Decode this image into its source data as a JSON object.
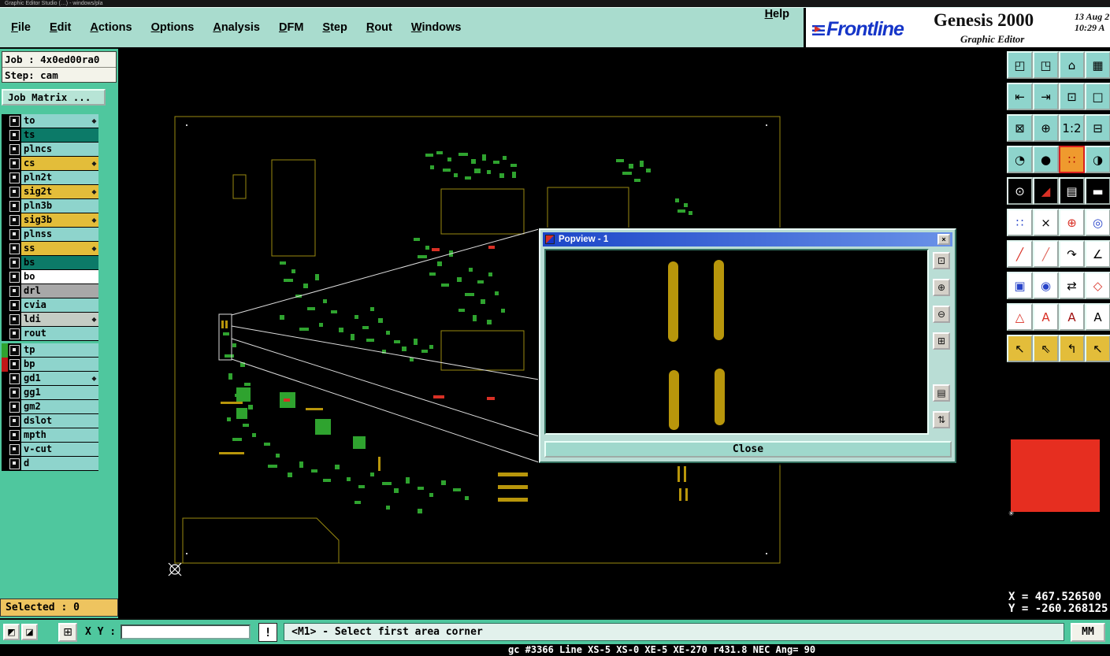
{
  "window_title": "Graphic Editor Studio (…) - windows/pla",
  "menubar": {
    "items": [
      {
        "label": "File",
        "name": "menu-file"
      },
      {
        "label": "Edit",
        "name": "menu-edit"
      },
      {
        "label": "Actions",
        "name": "menu-actions"
      },
      {
        "label": "Options",
        "name": "menu-options"
      },
      {
        "label": "Analysis",
        "name": "menu-analysis"
      },
      {
        "label": "DFM",
        "name": "menu-dfm"
      },
      {
        "label": "Step",
        "name": "menu-step"
      },
      {
        "label": "Rout",
        "name": "menu-rout"
      },
      {
        "label": "Windows",
        "name": "menu-windows"
      }
    ],
    "help_label": "Help"
  },
  "brand": {
    "logo_text": "Frontline",
    "product": "Genesis 2000",
    "subtitle": "Graphic Editor",
    "date": "13 Aug 2",
    "time": "10:29 A"
  },
  "job_panel": {
    "job_line": "Job : 4x0ed00ra0",
    "step_line": "Step: cam",
    "matrix_button": "Job Matrix ..."
  },
  "layers": [
    {
      "name": "to",
      "color": "#8ed4cc",
      "arrow_glyph": "◆",
      "swatch": ""
    },
    {
      "name": "ts",
      "color": "#0c7a68",
      "arrow_glyph": "",
      "swatch": ""
    },
    {
      "name": "plncs",
      "color": "#8ed4cc",
      "arrow_glyph": "",
      "swatch": ""
    },
    {
      "name": "cs",
      "color": "#e3bd3a",
      "arrow_glyph": "◆",
      "swatch": ""
    },
    {
      "name": "pln2t",
      "color": "#8ed4cc",
      "arrow_glyph": "",
      "swatch": ""
    },
    {
      "name": "sig2t",
      "color": "#e3bd3a",
      "arrow_glyph": "◆",
      "swatch": ""
    },
    {
      "name": "pln3b",
      "color": "#8ed4cc",
      "arrow_glyph": "",
      "swatch": ""
    },
    {
      "name": "sig3b",
      "color": "#e3bd3a",
      "arrow_glyph": "◆",
      "swatch": ""
    },
    {
      "name": "plnss",
      "color": "#8ed4cc",
      "arrow_glyph": "",
      "swatch": ""
    },
    {
      "name": "ss",
      "color": "#e3bd3a",
      "arrow_glyph": "◆",
      "swatch": ""
    },
    {
      "name": "bs",
      "color": "#0c7a68",
      "arrow_glyph": "",
      "swatch": ""
    },
    {
      "name": "bo",
      "color": "#ffffff",
      "arrow_glyph": "",
      "swatch": ""
    },
    {
      "name": "drl",
      "color": "#a8a8a8",
      "arrow_glyph": "",
      "swatch": ""
    },
    {
      "name": "cvia",
      "color": "#8ed4cc",
      "arrow_glyph": "",
      "swatch": ""
    },
    {
      "name": "ldi",
      "color": "#c4ccc4",
      "arrow_glyph": "◆",
      "swatch": ""
    },
    {
      "name": "rout",
      "color": "#8ed4cc",
      "arrow_glyph": "",
      "swatch": ""
    },
    {
      "name": "tp",
      "color": "#8ed4cc",
      "arrow_glyph": "",
      "swatch": "#2fa32f"
    },
    {
      "name": "bp",
      "color": "#8ed4cc",
      "arrow_glyph": "",
      "swatch": "#c01818"
    },
    {
      "name": "gd1",
      "color": "#8ed4cc",
      "arrow_glyph": "◆",
      "swatch": ""
    },
    {
      "name": "gg1",
      "color": "#8ed4cc",
      "arrow_glyph": "",
      "swatch": ""
    },
    {
      "name": "gm2",
      "color": "#8ed4cc",
      "arrow_glyph": "",
      "swatch": ""
    },
    {
      "name": "dslot",
      "color": "#8ed4cc",
      "arrow_glyph": "",
      "swatch": ""
    },
    {
      "name": "mpth",
      "color": "#8ed4cc",
      "arrow_glyph": "",
      "swatch": ""
    },
    {
      "name": "v-cut",
      "color": "#8ed4cc",
      "arrow_glyph": "",
      "swatch": ""
    },
    {
      "name": "d",
      "color": "#8ed4cc",
      "arrow_glyph": "",
      "swatch": ""
    }
  ],
  "popup": {
    "title": "Popview - 1",
    "close_x": "×",
    "close_button": "Close",
    "tools": [
      {
        "name": "popview-zoom-window-button",
        "glyph": "⊡"
      },
      {
        "name": "popview-zoom-in-button",
        "glyph": "⊕"
      },
      {
        "name": "popview-zoom-out-button",
        "glyph": "⊖"
      },
      {
        "name": "popview-zoom-fit-button",
        "glyph": "⊞"
      },
      {
        "name": "popview-layers-button",
        "glyph": "▤"
      },
      {
        "name": "popview-sync-button",
        "glyph": "⇅"
      }
    ]
  },
  "right_toolbar": [
    {
      "name": "view-screen-button",
      "glyph": "◰",
      "bg": "#8ed4cc",
      "fg": "#000000"
    },
    {
      "name": "view-pan-button",
      "glyph": "◳",
      "bg": "#8ed4cc",
      "fg": "#000000"
    },
    {
      "name": "view-home-button",
      "glyph": "⌂",
      "bg": "#8ed4cc",
      "fg": "#000000"
    },
    {
      "name": "view-tile-button",
      "glyph": "▦",
      "bg": "#8ed4cc",
      "fg": "#000000"
    },
    {
      "name": "pan-left-button",
      "glyph": "⇤",
      "bg": "#8ed4cc",
      "fg": "#000000"
    },
    {
      "name": "pan-right-button",
      "glyph": "⇥",
      "bg": "#8ed4cc",
      "fg": "#000000"
    },
    {
      "name": "zoom-window-button",
      "glyph": "⊡",
      "bg": "#8ed4cc",
      "fg": "#000000"
    },
    {
      "name": "zoom-frame-button",
      "glyph": "□",
      "bg": "#8ed4cc",
      "fg": "#000000"
    },
    {
      "name": "zoom-extents-button",
      "glyph": "⊠",
      "bg": "#8ed4cc",
      "fg": "#000000"
    },
    {
      "name": "zoom-center-button",
      "glyph": "⊕",
      "bg": "#8ed4cc",
      "fg": "#000000"
    },
    {
      "name": "zoom-ratio-button",
      "glyph": "1:2",
      "bg": "#8ed4cc",
      "fg": "#000000"
    },
    {
      "name": "zoom-section-button",
      "glyph": "⊟",
      "bg": "#8ed4cc",
      "fg": "#000000"
    },
    {
      "name": "clock-tool-button",
      "glyph": "◔",
      "bg": "#8ed4cc",
      "fg": "#000000"
    },
    {
      "name": "pin-tool-button",
      "glyph": "●",
      "bg": "#8ed4cc",
      "fg": "#000000"
    },
    {
      "name": "pattern-select-button",
      "glyph": "∷",
      "bg": "#ef9a2e",
      "fg": "#b00000"
    },
    {
      "name": "contrast-tool-button",
      "glyph": "◑",
      "bg": "#8ed4cc",
      "fg": "#000000"
    },
    {
      "name": "center-point-button",
      "glyph": "⊙",
      "bg": "#000000",
      "fg": "#ffffff"
    },
    {
      "name": "corner-clip-button",
      "glyph": "◢",
      "bg": "#000000",
      "fg": "#d93025"
    },
    {
      "name": "ruler-button",
      "glyph": "▤",
      "bg": "#000000",
      "fg": "#ffffff"
    },
    {
      "name": "bar-tool-button",
      "glyph": "▬",
      "bg": "#000000",
      "fg": "#ffffff"
    },
    {
      "name": "pad-pattern-button",
      "glyph": "∷",
      "bg": "#ffffff",
      "fg": "#2743c9"
    },
    {
      "name": "delete-tool-button",
      "glyph": "×",
      "bg": "#ffffff",
      "fg": "#000000"
    },
    {
      "name": "circle-add-button",
      "glyph": "⊕",
      "bg": "#ffffff",
      "fg": "#d93025"
    },
    {
      "name": "reference-button",
      "glyph": "◎",
      "bg": "#ffffff",
      "fg": "#2743c9"
    },
    {
      "name": "line-heavy-button",
      "glyph": "╱",
      "bg": "#ffffff",
      "fg": "#d93025"
    },
    {
      "name": "line-light-button",
      "glyph": "╱",
      "bg": "#ffffff",
      "fg": "#e06a60"
    },
    {
      "name": "arc-tool-button",
      "glyph": "↷",
      "bg": "#ffffff",
      "fg": "#000000"
    },
    {
      "name": "angle-tool-button",
      "glyph": "∠",
      "bg": "#ffffff",
      "fg": "#000000"
    },
    {
      "name": "pad-swap-button",
      "glyph": "▣",
      "bg": "#ffffff",
      "fg": "#2743c9"
    },
    {
      "name": "target-button",
      "glyph": "◉",
      "bg": "#ffffff",
      "fg": "#2743c9"
    },
    {
      "name": "transfer-button",
      "glyph": "⇄",
      "bg": "#ffffff",
      "fg": "#000000"
    },
    {
      "name": "flash-tool-button",
      "glyph": "◇",
      "bg": "#ffffff",
      "fg": "#d93025"
    },
    {
      "name": "triangle-measure-button",
      "glyph": "△",
      "bg": "#ffffff",
      "fg": "#d93025"
    },
    {
      "name": "text-outline-button",
      "glyph": "A",
      "bg": "#ffffff",
      "fg": "#d93025"
    },
    {
      "name": "text-bold-button",
      "glyph": "A",
      "bg": "#ffffff",
      "fg": "#a01010"
    },
    {
      "name": "text-plain-button",
      "glyph": "A",
      "bg": "#ffffff",
      "fg": "#000000"
    },
    {
      "name": "select-cursor-button",
      "glyph": "↖",
      "bg": "#e3bd3a",
      "fg": "#000000"
    },
    {
      "name": "select-cursor-alt-button",
      "glyph": "⇖",
      "bg": "#e3bd3a",
      "fg": "#000000"
    },
    {
      "name": "select-corner-button",
      "glyph": "↰",
      "bg": "#e3bd3a",
      "fg": "#000000"
    },
    {
      "name": "select-area-button",
      "glyph": "↖",
      "bg": "#e3bd3a",
      "fg": "#000000"
    }
  ],
  "statusbar": {
    "left_buttons": [
      {
        "name": "negative-layer-button",
        "glyph": "◩"
      },
      {
        "name": "positive-layer-button",
        "glyph": "◪"
      },
      {
        "name": "grid-toggle-button",
        "glyph": "⊞"
      }
    ],
    "xy_label": "X Y :",
    "xy_value": "",
    "alert_button": "!",
    "prompt": "<M1> - Select first area corner",
    "units_button": "MM"
  },
  "selected_bar": "Selected : 0",
  "nav_readout": {
    "x": "X = 467.526500",
    "y": "Y = -260.268125"
  },
  "log_line": "gc #3366 Line XS-5 XS-0 XE-5 XE-270 r431.8 NEC Ang= 90"
}
